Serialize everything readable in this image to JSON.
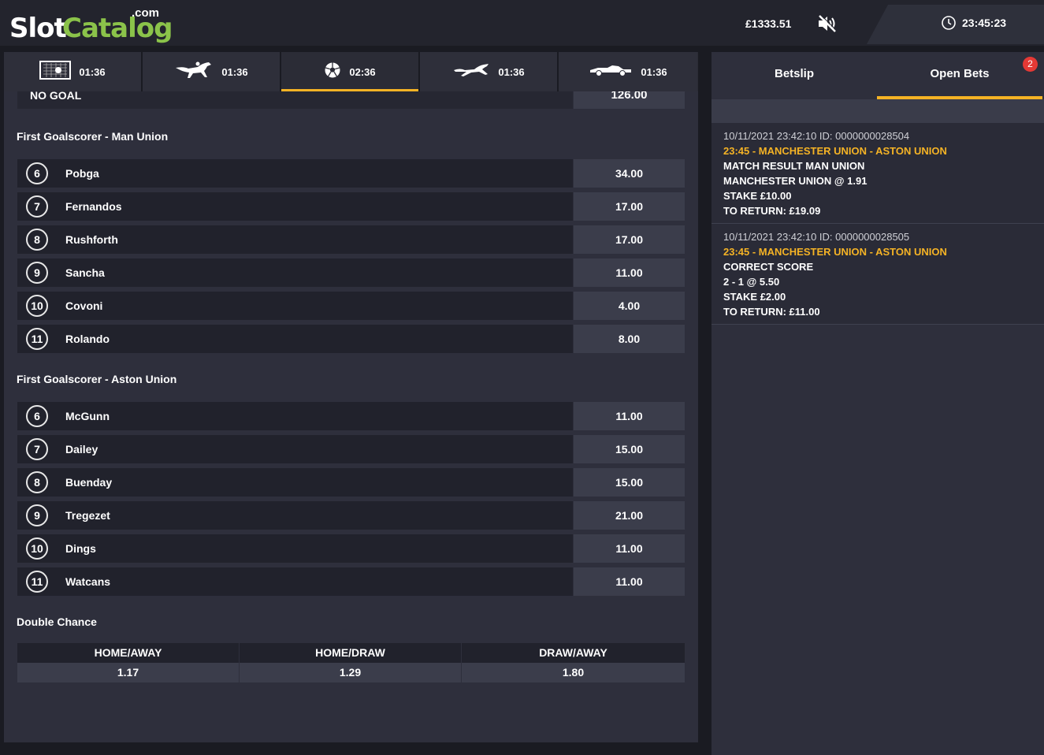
{
  "header": {
    "logo": {
      "slot": "Slot",
      "catalog": "Catalog",
      "com": ".com"
    },
    "balance": "£1333.51",
    "time": "23:45:23",
    "icons": {
      "mute": "mute-icon",
      "clock": "clock-icon"
    }
  },
  "game_tabs": [
    {
      "icon": "goal-icon",
      "time": "01:36",
      "active": false
    },
    {
      "icon": "horse-racing-icon",
      "time": "01:36",
      "active": false
    },
    {
      "icon": "football-icon",
      "time": "02:36",
      "active": true
    },
    {
      "icon": "greyhound-icon",
      "time": "01:36",
      "active": false
    },
    {
      "icon": "race-car-icon",
      "time": "01:36",
      "active": false
    }
  ],
  "market": {
    "cut_row": {
      "name": "NO GOAL",
      "odds": "126.00"
    },
    "first_scorer_home": {
      "title": "First Goalscorer - Man Union",
      "rows": [
        {
          "num": "6",
          "player": "Pobga",
          "odds": "34.00"
        },
        {
          "num": "7",
          "player": "Fernandos",
          "odds": "17.00"
        },
        {
          "num": "8",
          "player": "Rushforth",
          "odds": "17.00"
        },
        {
          "num": "9",
          "player": "Sancha",
          "odds": "11.00"
        },
        {
          "num": "10",
          "player": "Covoni",
          "odds": "4.00"
        },
        {
          "num": "11",
          "player": "Rolando",
          "odds": "8.00"
        }
      ]
    },
    "first_scorer_away": {
      "title": "First Goalscorer - Aston Union",
      "rows": [
        {
          "num": "6",
          "player": "McGunn",
          "odds": "11.00"
        },
        {
          "num": "7",
          "player": "Dailey",
          "odds": "15.00"
        },
        {
          "num": "8",
          "player": "Buenday",
          "odds": "15.00"
        },
        {
          "num": "9",
          "player": "Tregezet",
          "odds": "21.00"
        },
        {
          "num": "10",
          "player": "Dings",
          "odds": "11.00"
        },
        {
          "num": "11",
          "player": "Watcans",
          "odds": "11.00"
        }
      ]
    },
    "double_chance": {
      "title": "Double Chance",
      "options": [
        {
          "label": "HOME/AWAY",
          "odds": "1.17"
        },
        {
          "label": "HOME/DRAW",
          "odds": "1.29"
        },
        {
          "label": "DRAW/AWAY",
          "odds": "1.80"
        }
      ]
    }
  },
  "right_panel": {
    "tabs": [
      {
        "label": "Betslip",
        "active": false
      },
      {
        "label": "Open Bets",
        "active": true
      }
    ],
    "badge": "2",
    "bets": [
      {
        "meta": "10/11/2021 23:42:10 ID: 0000000028504",
        "event": "23:45 - MANCHESTER UNION - ASTON UNION",
        "market": "MATCH RESULT MAN UNION",
        "selection": "MANCHESTER UNION @ 1.91",
        "stake": "STAKE £10.00",
        "return": "TO RETURN: £19.09"
      },
      {
        "meta": "10/11/2021 23:42:10 ID: 0000000028505",
        "event": "23:45 - MANCHESTER UNION - ASTON UNION",
        "market": "CORRECT SCORE",
        "selection": "2 - 1 @ 5.50",
        "stake": "STAKE £2.00",
        "return": "TO RETURN: £11.00"
      }
    ]
  },
  "colors": {
    "accent": "#f5b325",
    "brand_green": "#8bc34a",
    "badge": "#e53935"
  }
}
